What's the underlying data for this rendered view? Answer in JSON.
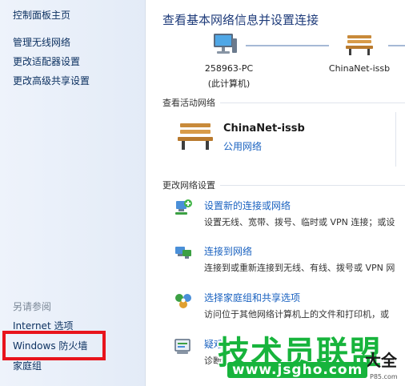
{
  "sidebar": {
    "home": "控制面板主页",
    "items": [
      "管理无线网络",
      "更改适配器设置",
      "更改高级共享设置"
    ],
    "see_also_heading": "另请参阅",
    "see_also": [
      "Internet 选项",
      "Windows 防火墙",
      "家庭组"
    ]
  },
  "main": {
    "title": "查看基本网络信息并设置连接",
    "map": {
      "pc_name": "258963-PC",
      "pc_sub": "(此计算机)",
      "network": "ChinaNet-issb"
    },
    "active_heading": "查看活动网络",
    "active": {
      "name": "ChinaNet-issb",
      "type": "公用网络"
    },
    "change_heading": "更改网络设置",
    "tasks": [
      {
        "link": "设置新的连接或网络",
        "desc": "设置无线、宽带、拨号、临时或 VPN 连接；或设"
      },
      {
        "link": "连接到网络",
        "desc": "连接到或重新连接到无线、有线、拨号或 VPN 网"
      },
      {
        "link": "选择家庭组和共享选项",
        "desc": "访问位于其他网络计算机上的文件和打印机，或"
      },
      {
        "link": "疑难",
        "desc": "诊断"
      }
    ]
  },
  "watermark": {
    "title": "技术员联盟",
    "side": "大全",
    "url": "www.jsgho.com",
    "small": "P85.com"
  },
  "colors": {
    "highlight": "#e8141c",
    "link": "#1a62c0",
    "watermark": "#17b43c"
  }
}
